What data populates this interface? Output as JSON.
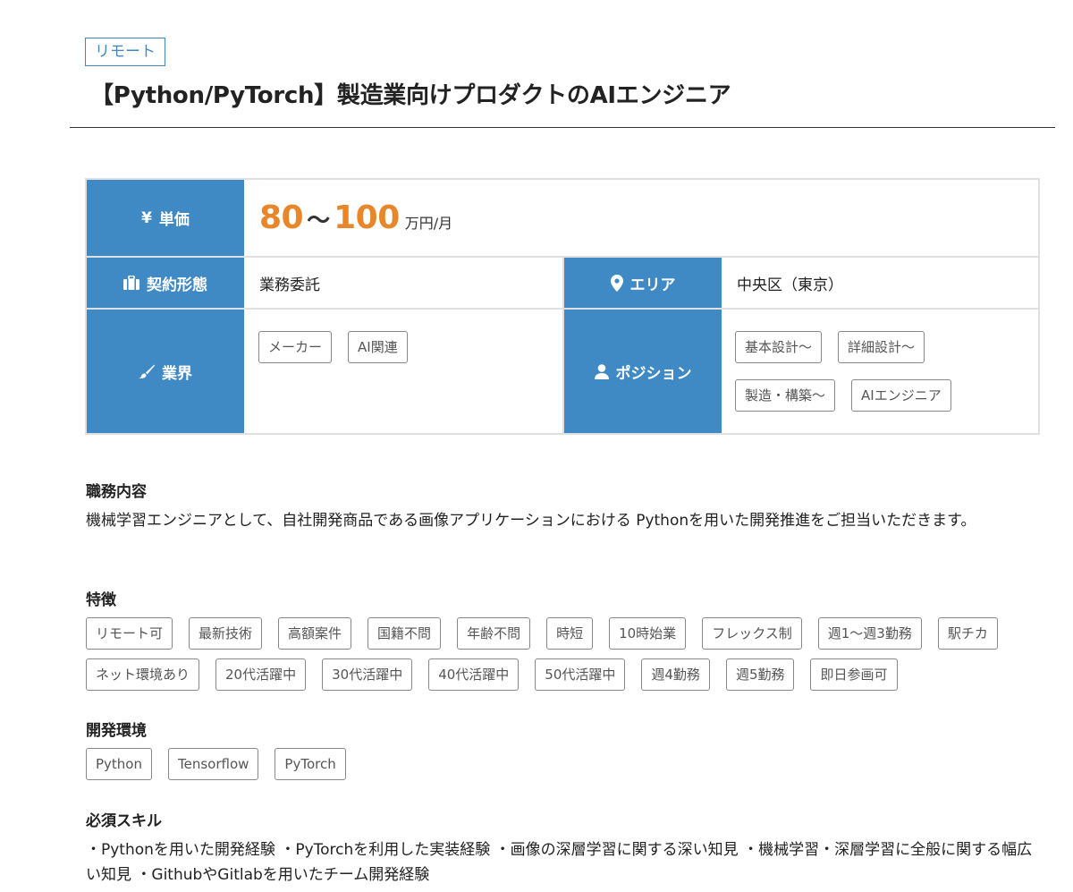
{
  "remote_badge": "リモート",
  "title": "【Python/PyTorch】製造業向けプロダクトのAIエンジニア",
  "info": {
    "price_label": "単価",
    "price_icon": "yen-icon",
    "price_min": "80",
    "price_tilde": "〜",
    "price_max": "100",
    "price_unit": "万円/月",
    "contract_label": "契約形態",
    "contract_icon": "briefcase-icon",
    "contract_value": "業務委託",
    "area_label": "エリア",
    "area_icon": "map-pin-icon",
    "area_value": "中央区（東京）",
    "industry_label": "業界",
    "industry_icon": "brush-icon",
    "industry_tags": [
      "メーカー",
      "AI関連"
    ],
    "position_label": "ポジション",
    "position_icon": "user-icon",
    "position_tags": [
      "基本設計〜",
      "詳細設計〜",
      "製造・構築〜",
      "AIエンジニア"
    ]
  },
  "duties": {
    "heading": "職務内容",
    "text": "機械学習エンジニアとして、自社開発商品である画像アプリケーションにおける Pythonを用いた開発推進をご担当いただきます。"
  },
  "features": {
    "heading": "特徴",
    "tags": [
      "リモート可",
      "最新技術",
      "高額案件",
      "国籍不問",
      "年齢不問",
      "時短",
      "10時始業",
      "フレックス制",
      "週1〜週3勤務",
      "駅チカ",
      "ネット環境あり",
      "20代活躍中",
      "30代活躍中",
      "40代活躍中",
      "50代活躍中",
      "週4勤務",
      "週5勤務",
      "即日参画可"
    ]
  },
  "environment": {
    "heading": "開発環境",
    "tags": [
      "Python",
      "Tensorflow",
      "PyTorch"
    ]
  },
  "skills": {
    "heading": "必須スキル",
    "text": "・Pythonを用いた開発経験 ・PyTorchを利用した実装経験 ・画像の深層学習に関する深い知見 ・機械学習・深層学習に全般に関する幅広い知見 ・GithubやGitlabを用いたチーム開発経験"
  },
  "colors": {
    "accent": "#3f8ac5",
    "price": "#e8862a"
  }
}
